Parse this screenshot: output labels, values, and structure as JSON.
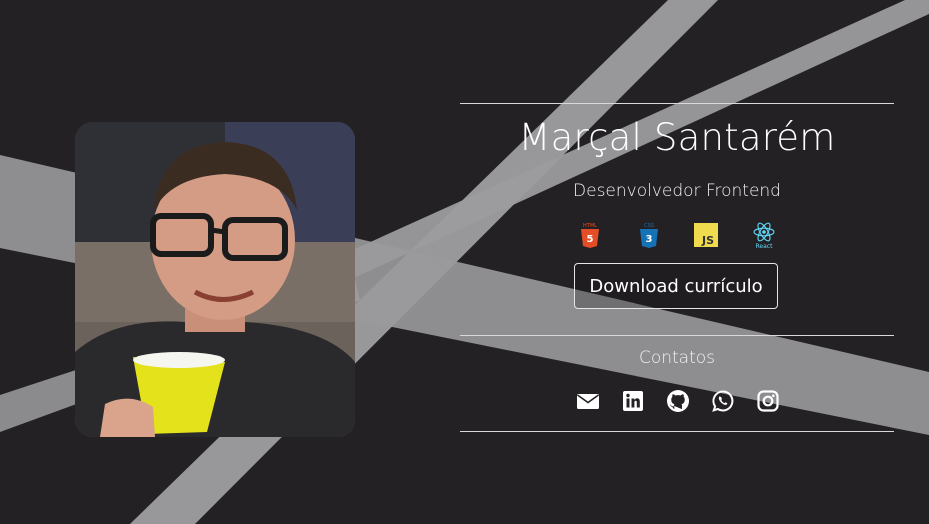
{
  "profile": {
    "name": "Marçal Santarém",
    "role": "Desenvolvedor Frontend",
    "photo_alt": "Foto de perfil"
  },
  "techs": [
    {
      "label": "HTML",
      "icon": "html5-icon",
      "color": "#e44d26"
    },
    {
      "label": "CSS",
      "icon": "css3-icon",
      "color": "#1572b6"
    },
    {
      "label": "JS",
      "icon": "javascript-icon",
      "color": "#f0db4f"
    },
    {
      "label": "React",
      "icon": "react-icon",
      "color": "#61dafb"
    }
  ],
  "download_button": {
    "label": "Download currículo"
  },
  "contacts": {
    "title": "Contatos",
    "items": [
      {
        "icon": "email-icon"
      },
      {
        "icon": "linkedin-icon"
      },
      {
        "icon": "github-icon"
      },
      {
        "icon": "whatsapp-icon"
      },
      {
        "icon": "instagram-icon"
      }
    ]
  },
  "colors": {
    "background": "#242124",
    "text": "#ffffff",
    "beam": "#a6a6a8"
  }
}
